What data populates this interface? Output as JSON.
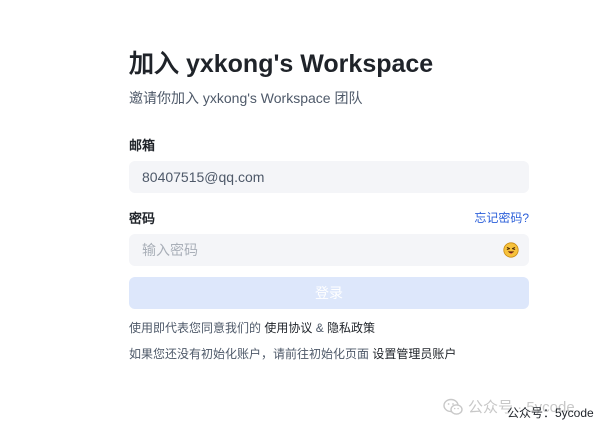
{
  "login": {
    "title": "加入 yxkong's Workspace",
    "subtitle": "邀请你加入 yxkong's Workspace 团队",
    "email": {
      "label": "邮箱",
      "value": "80407515@qq.com"
    },
    "password": {
      "label": "密码",
      "forgot_label": "忘记密码?",
      "placeholder": "输入密码",
      "toggle_icon": "emoji-icon"
    },
    "submit_label": "登录",
    "agreement": {
      "prefix": "使用即代表您同意我们的 ",
      "terms_label": "使用协议",
      "separator": " & ",
      "privacy_label": "隐私政策"
    },
    "init_note": {
      "prefix": "如果您还没有初始化账户，请前往初始化页面 ",
      "link_label": "设置管理员账户"
    }
  },
  "watermark": {
    "faded_text": "公众号 · 5ycode",
    "overlay_text": "公众号：5ycode",
    "icon": "wechat-icon"
  },
  "colors": {
    "accent": "#2b5fd9",
    "button_disabled_bg": "#dde7fb",
    "input_bg": "#f4f5f8"
  }
}
